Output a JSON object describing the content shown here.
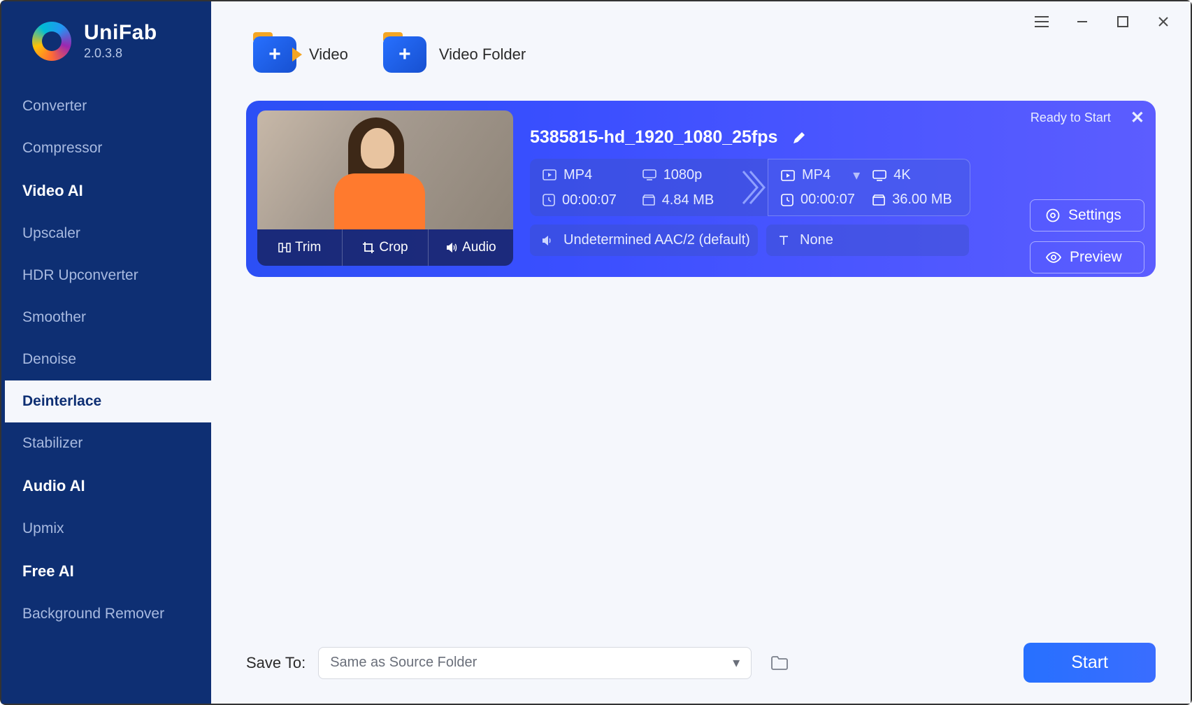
{
  "brand": {
    "name": "UniFab",
    "version": "2.0.3.8"
  },
  "sidebar": {
    "items": [
      {
        "label": "Converter",
        "type": "item"
      },
      {
        "label": "Compressor",
        "type": "item"
      },
      {
        "label": "Video AI",
        "type": "section"
      },
      {
        "label": "Upscaler",
        "type": "item"
      },
      {
        "label": "HDR Upconverter",
        "type": "item"
      },
      {
        "label": "Smoother",
        "type": "item"
      },
      {
        "label": "Denoise",
        "type": "item"
      },
      {
        "label": "Deinterlace",
        "type": "item",
        "active": true
      },
      {
        "label": "Stabilizer",
        "type": "item"
      },
      {
        "label": "Audio AI",
        "type": "section"
      },
      {
        "label": "Upmix",
        "type": "item"
      },
      {
        "label": "Free AI",
        "type": "section"
      },
      {
        "label": "Background Remover",
        "type": "item"
      }
    ]
  },
  "addRow": {
    "video": "Video",
    "folder": "Video Folder"
  },
  "task": {
    "status": "Ready to Start",
    "filename": "5385815-hd_1920_1080_25fps",
    "thumbActions": {
      "trim": "Trim",
      "crop": "Crop",
      "audio": "Audio"
    },
    "source": {
      "format": "MP4",
      "resolution": "1080p",
      "duration": "00:00:07",
      "size": "4.84 MB"
    },
    "target": {
      "format": "MP4",
      "resolution": "4K",
      "duration": "00:00:07",
      "size": "36.00 MB"
    },
    "buttons": {
      "settings": "Settings",
      "preview": "Preview"
    },
    "audioTrack": "Undetermined AAC/2 (default)",
    "subtitleTrack": "None"
  },
  "footer": {
    "saveLabel": "Save To:",
    "savePath": "Same as Source Folder",
    "start": "Start"
  }
}
